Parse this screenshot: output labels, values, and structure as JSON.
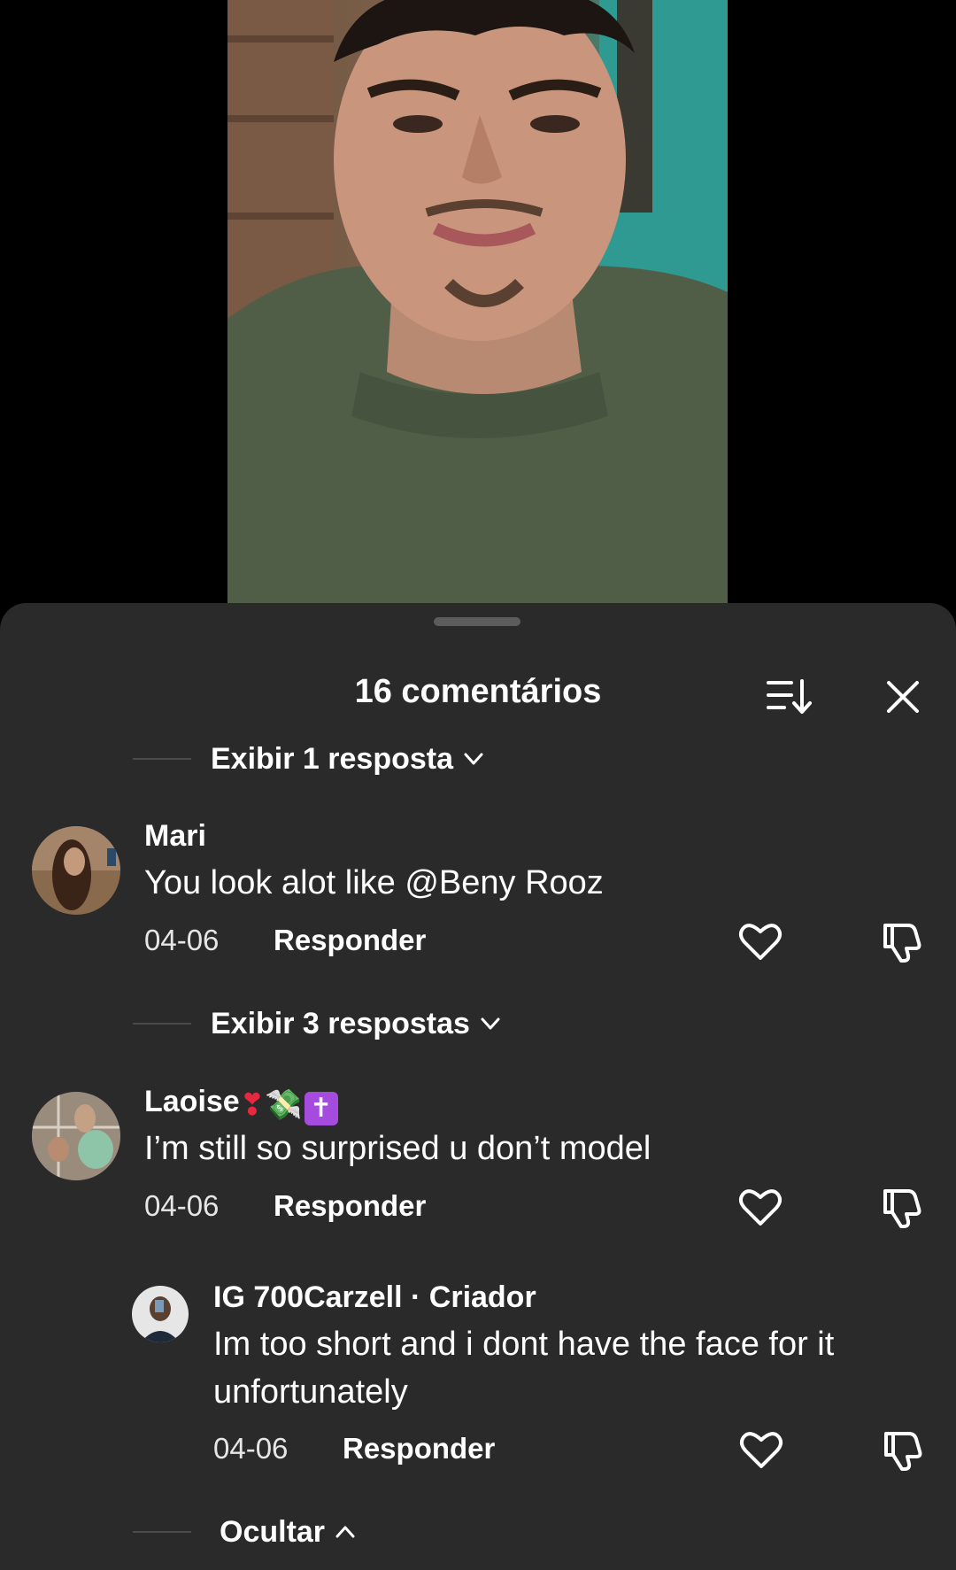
{
  "header": {
    "title": "16 comentários"
  },
  "expanders": {
    "first": "Exibir 1 resposta",
    "second": "Exibir 3 respostas",
    "hide": "Ocultar"
  },
  "comments": [
    {
      "user": "Mari",
      "text": "You look alot like @Beny Rooz",
      "date": "04-06",
      "reply_label": "Responder"
    },
    {
      "user": "Laoise",
      "user_emojis": [
        "❣",
        "💸",
        "✝"
      ],
      "text": "I’m still so surprised u don’t model",
      "date": "04-06",
      "reply_label": "Responder"
    }
  ],
  "reply": {
    "user": "IG 700Carzell · Criador",
    "text": "Im too short and i dont have the face for it unfortunately",
    "date": "04-06",
    "reply_label": "Responder"
  },
  "colors": {
    "sheet_background": "#2a2a2a",
    "accent_heart": "#e8283f",
    "badge_purple": "#a54cdf"
  },
  "icons": {
    "sort": "sort-icon",
    "close": "close-icon",
    "like": "heart-icon",
    "dislike": "thumbs-down-icon",
    "expand": "chevron-down-icon",
    "collapse": "chevron-up-icon"
  }
}
